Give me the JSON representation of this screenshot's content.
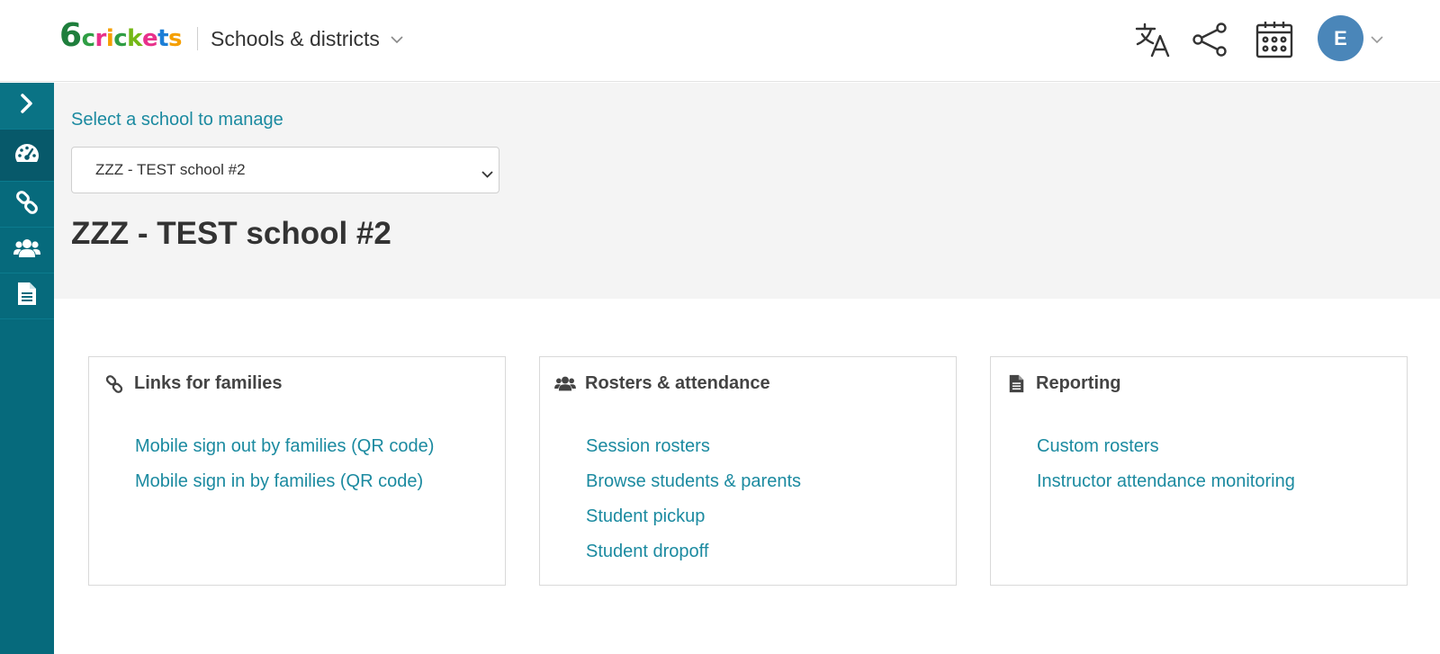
{
  "header": {
    "logo": {
      "six": "6",
      "letters": [
        "c",
        "r",
        "i",
        "c",
        "k",
        "e",
        "t",
        "s"
      ],
      "colors": [
        "#2f9e44",
        "#e8318b",
        "#f59f00",
        "#2f9e44",
        "#74b816",
        "#e8318b",
        "#1c7ed6",
        "#f59f00"
      ],
      "six_color": "#1e7e3c"
    },
    "title": "Schools & districts",
    "icons": [
      "translate-icon",
      "share-icon",
      "calendar-icon"
    ],
    "avatar_initial": "E",
    "avatar_color": "#4a86b9"
  },
  "sidebar": {
    "items": [
      {
        "name": "sidebar-toggle",
        "icon": "chevron-right-icon"
      },
      {
        "name": "sidebar-item-dashboard",
        "icon": "dashboard-icon",
        "active": true
      },
      {
        "name": "sidebar-item-links",
        "icon": "link-icon"
      },
      {
        "name": "sidebar-item-rosters",
        "icon": "users-icon"
      },
      {
        "name": "sidebar-item-reporting",
        "icon": "document-icon"
      }
    ],
    "bg_color": "#066a7c"
  },
  "main": {
    "select_label": "Select a school to manage",
    "selected_school": "ZZZ - TEST school #2",
    "heading": "ZZZ - TEST school #2"
  },
  "cards": [
    {
      "title": "Links for families",
      "icon": "link-icon",
      "links": [
        "Mobile sign out by families (QR code)",
        "Mobile sign in by families (QR code)"
      ]
    },
    {
      "title": "Rosters & attendance",
      "icon": "users-icon",
      "links": [
        "Session rosters",
        "Browse students & parents",
        "Student pickup",
        "Student dropoff"
      ]
    },
    {
      "title": "Reporting",
      "icon": "document-icon",
      "links": [
        "Custom rosters",
        "Instructor attendance monitoring"
      ]
    }
  ],
  "accent_color": "#1b8aa0"
}
